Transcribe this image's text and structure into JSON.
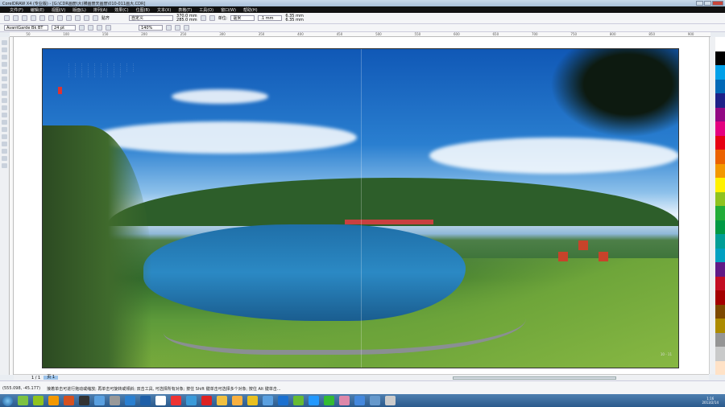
{
  "window": {
    "title": "CorelDRAW X4 (专业版) - [G:\\CDR画册\\大)横画册天画册\\010-011画大.CDR]"
  },
  "menu": [
    "文件(F)",
    "编辑(E)",
    "视图(V)",
    "版面(L)",
    "排列(A)",
    "效果(C)",
    "位图(B)",
    "文本(X)",
    "表格(T)",
    "工具(O)",
    "窗口(W)",
    "帮助(H)"
  ],
  "toolbar": {
    "snap_label": "贴齐",
    "page_size": "自定义",
    "width": "370.0 mm",
    "height": "285.0 mm",
    "units_label": "单位:",
    "units": "毫米",
    "nudge": ".1 mm",
    "dup_x": "6.35 mm",
    "dup_y": "6.35 mm"
  },
  "propertybar": {
    "font": "AvantGarde Bk BT",
    "font_size": "24 pt",
    "zoom": "140%"
  },
  "ruler_ticks": [
    "50",
    "100",
    "150",
    "200",
    "250",
    "300",
    "350",
    "400",
    "450",
    "500",
    "550",
    "600",
    "650",
    "700",
    "750",
    "800",
    "850",
    "900"
  ],
  "document": {
    "page_number": "10 - 11"
  },
  "pager": {
    "count": "1 / 1",
    "tab": "页 1"
  },
  "status": {
    "coords": "(555.098, -45.177)",
    "hint": "接着单击可进行拖动或缩放; 再单击可旋转或倾斜; 双击工具, 可选择所有对象; 按住 Shift 键单击可选择多个对象; 按住 Alt 键单击..."
  },
  "clock": {
    "time": "1:16",
    "date": "2013/2/14"
  },
  "colors": {
    "palette": [
      "#ffffff",
      "#000000",
      "#00a0e9",
      "#0068b7",
      "#1d2088",
      "#920783",
      "#e4007f",
      "#e60012",
      "#eb6100",
      "#f39800",
      "#fff100",
      "#8fc31f",
      "#22ac38",
      "#009944",
      "#009e96",
      "#00a0c1",
      "#601986",
      "#c30d23",
      "#a40000",
      "#7d4900",
      "#ad8b00",
      "#959595",
      "#c9caca",
      "#ffe2c7"
    ]
  },
  "taskbar_icons": [
    "start-icon",
    "browser360-icon",
    "coreldraw-icon",
    "illustrator-icon",
    "indesign-icon",
    "office-icon",
    "network-icon",
    "image-icon",
    "app-icon",
    "photoshop-icon",
    "kugou-icon",
    "qq-icon",
    "browser-icon",
    "mail-icon",
    "folder-icon",
    "outlook-icon",
    "bird-icon",
    "messenger-icon",
    "player-icon",
    "parrot-icon",
    "ie-icon",
    "ie2-icon",
    "360-icon",
    "windows-icon",
    "tool-icon",
    "notepad-icon"
  ]
}
